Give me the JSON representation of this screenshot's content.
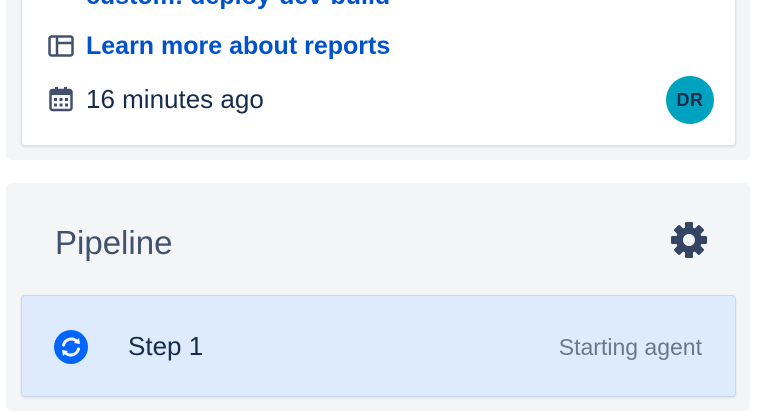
{
  "build_card": {
    "branch_link_text": "custom: deploy-dev-build",
    "report_link_label": "Learn more about reports",
    "report_icon": "report-icon",
    "time_icon": "calendar-icon",
    "time_ago": "16 minutes ago",
    "avatar_initials": "DR",
    "avatar_color": "#00a3bf"
  },
  "pipeline": {
    "title": "Pipeline",
    "settings_icon": "gear-icon",
    "steps": [
      {
        "icon": "in-progress-icon",
        "name": "Step 1",
        "status": "Starting agent"
      }
    ]
  },
  "colors": {
    "link": "#0052cc",
    "step_bg": "#deebff",
    "progress_icon": "#0065ff",
    "panel_bg": "#f4f5f7"
  }
}
